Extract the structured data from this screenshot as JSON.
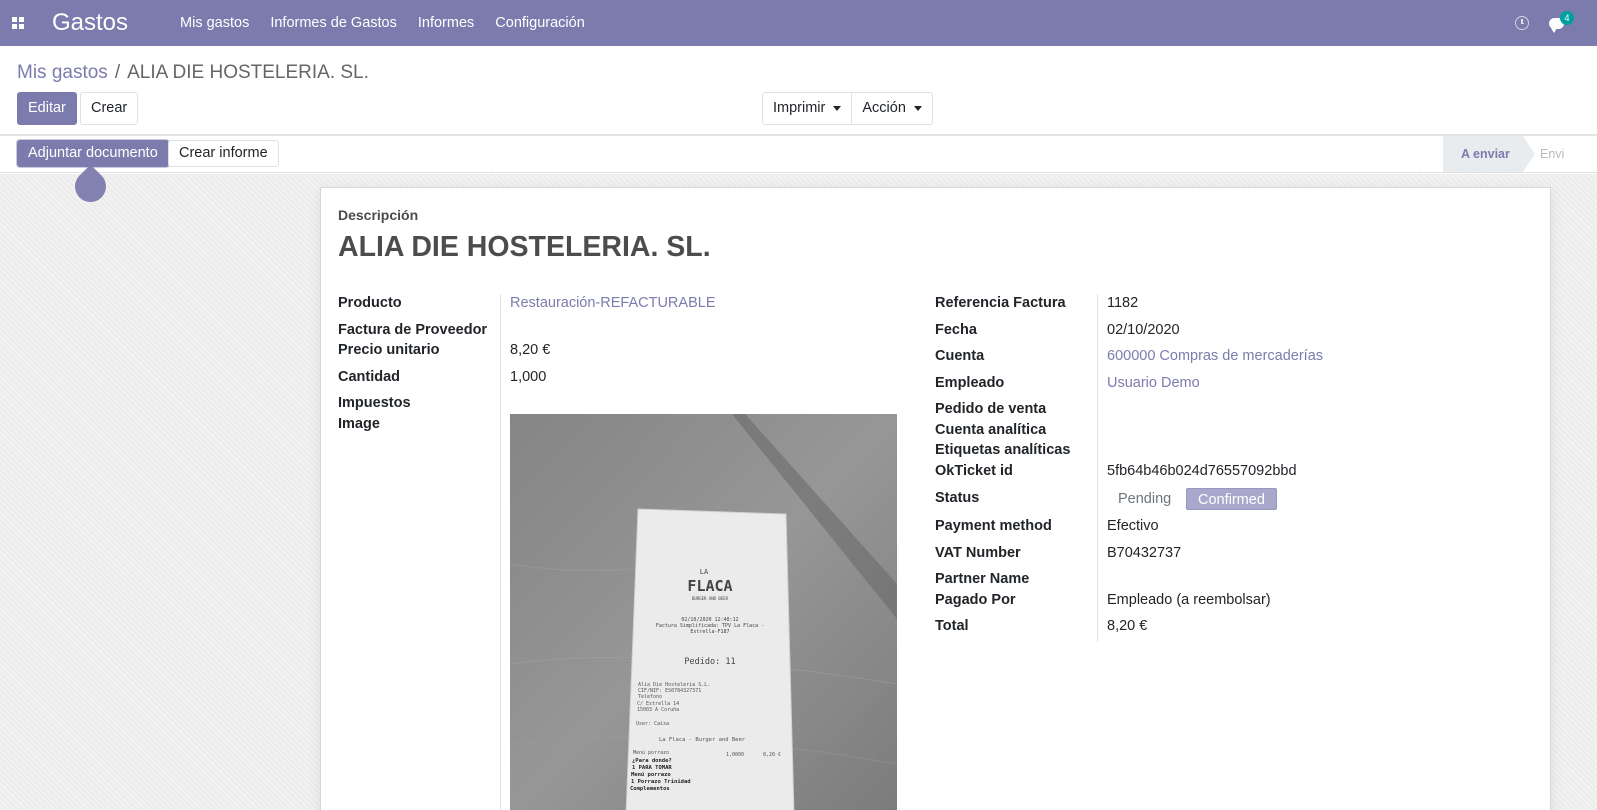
{
  "navbar": {
    "app_name": "Gastos",
    "menu": [
      "Mis gastos",
      "Informes de Gastos",
      "Informes",
      "Configuración"
    ],
    "chat_badge": "4",
    "icons": [
      "apps-grid-icon",
      "clock-icon",
      "chat-icon"
    ],
    "color": "#7c7bad"
  },
  "breadcrumb": {
    "parent": "Mis gastos",
    "separator": "/",
    "current": "ALIA DIE HOSTELERIA. SL."
  },
  "buttons": {
    "edit": "Editar",
    "create": "Crear",
    "print": "Imprimir",
    "action": "Acción"
  },
  "statusbar": {
    "attach": "Adjuntar documento",
    "create_report": "Crear informe",
    "stage_current": "A enviar",
    "stage_next": "Envi"
  },
  "form": {
    "desc_label": "Descripción",
    "title": "ALIA DIE HOSTELERIA. SL.",
    "left": {
      "producto": {
        "label": "Producto",
        "value": "Restauración-REFACTURABLE"
      },
      "factura": {
        "label": "Factura de Proveedor",
        "value": ""
      },
      "precio": {
        "label": "Precio unitario",
        "value": "8,20 €"
      },
      "cantidad": {
        "label": "Cantidad",
        "value": "1,000"
      },
      "impuestos": {
        "label": "Impuestos",
        "value": ""
      },
      "image": {
        "label": "Image"
      }
    },
    "right": {
      "referencia": {
        "label": "Referencia Factura",
        "value": "1182"
      },
      "fecha": {
        "label": "Fecha",
        "value": "02/10/2020"
      },
      "cuenta": {
        "label": "Cuenta",
        "value": "600000 Compras de mercaderías"
      },
      "empleado": {
        "label": "Empleado",
        "value": "Usuario Demo"
      },
      "pedido": {
        "label": "Pedido de venta",
        "value": ""
      },
      "cuenta_analitica": {
        "label": "Cuenta analítica",
        "value": ""
      },
      "etiquetas": {
        "label": "Etiquetas analíticas",
        "value": ""
      },
      "okticket": {
        "label": "OkTicket id",
        "value": "5fb64b46b024d76557092bbd"
      },
      "status": {
        "label": "Status",
        "options": [
          "Pending",
          "Confirmed"
        ],
        "selected": "Confirmed"
      },
      "payment": {
        "label": "Payment method",
        "value": "Efectivo"
      },
      "vat": {
        "label": "VAT Number",
        "value": "B70432737"
      },
      "partner": {
        "label": "Partner Name",
        "value": ""
      },
      "pagado": {
        "label": "Pagado Por",
        "value": "Empleado (a reembolsar)"
      },
      "total": {
        "label": "Total",
        "value": "8,20 €"
      }
    },
    "receipt": {
      "logo_top": "LA",
      "logo": "FLACA",
      "logo_sub": "BURGER AND BEER",
      "header_lines": [
        "02/10/2020 12:40:12",
        "Factura Simplificada: TPV La Flaca -",
        "Estrella-F187"
      ],
      "pedido": "Pedido: 11",
      "company_lines": [
        "Alia Die Hosteleria S.L.",
        "CIF/NIF: ES0784327371",
        "Telefono",
        "C/ Estrella 14",
        "15003 A Coruña"
      ],
      "user_line": "User: Caixa",
      "shop_line": "La Flaca - Burger and Beer",
      "item_name": "Menú porrazo",
      "item_qty": "1,0000",
      "item_price": "8,20 €",
      "item_lines": [
        "¿Para donde?",
        "1  PARA TOMAR",
        "Menú porrazo",
        "1  Porrazo Trinidad",
        "Complementos"
      ]
    }
  }
}
